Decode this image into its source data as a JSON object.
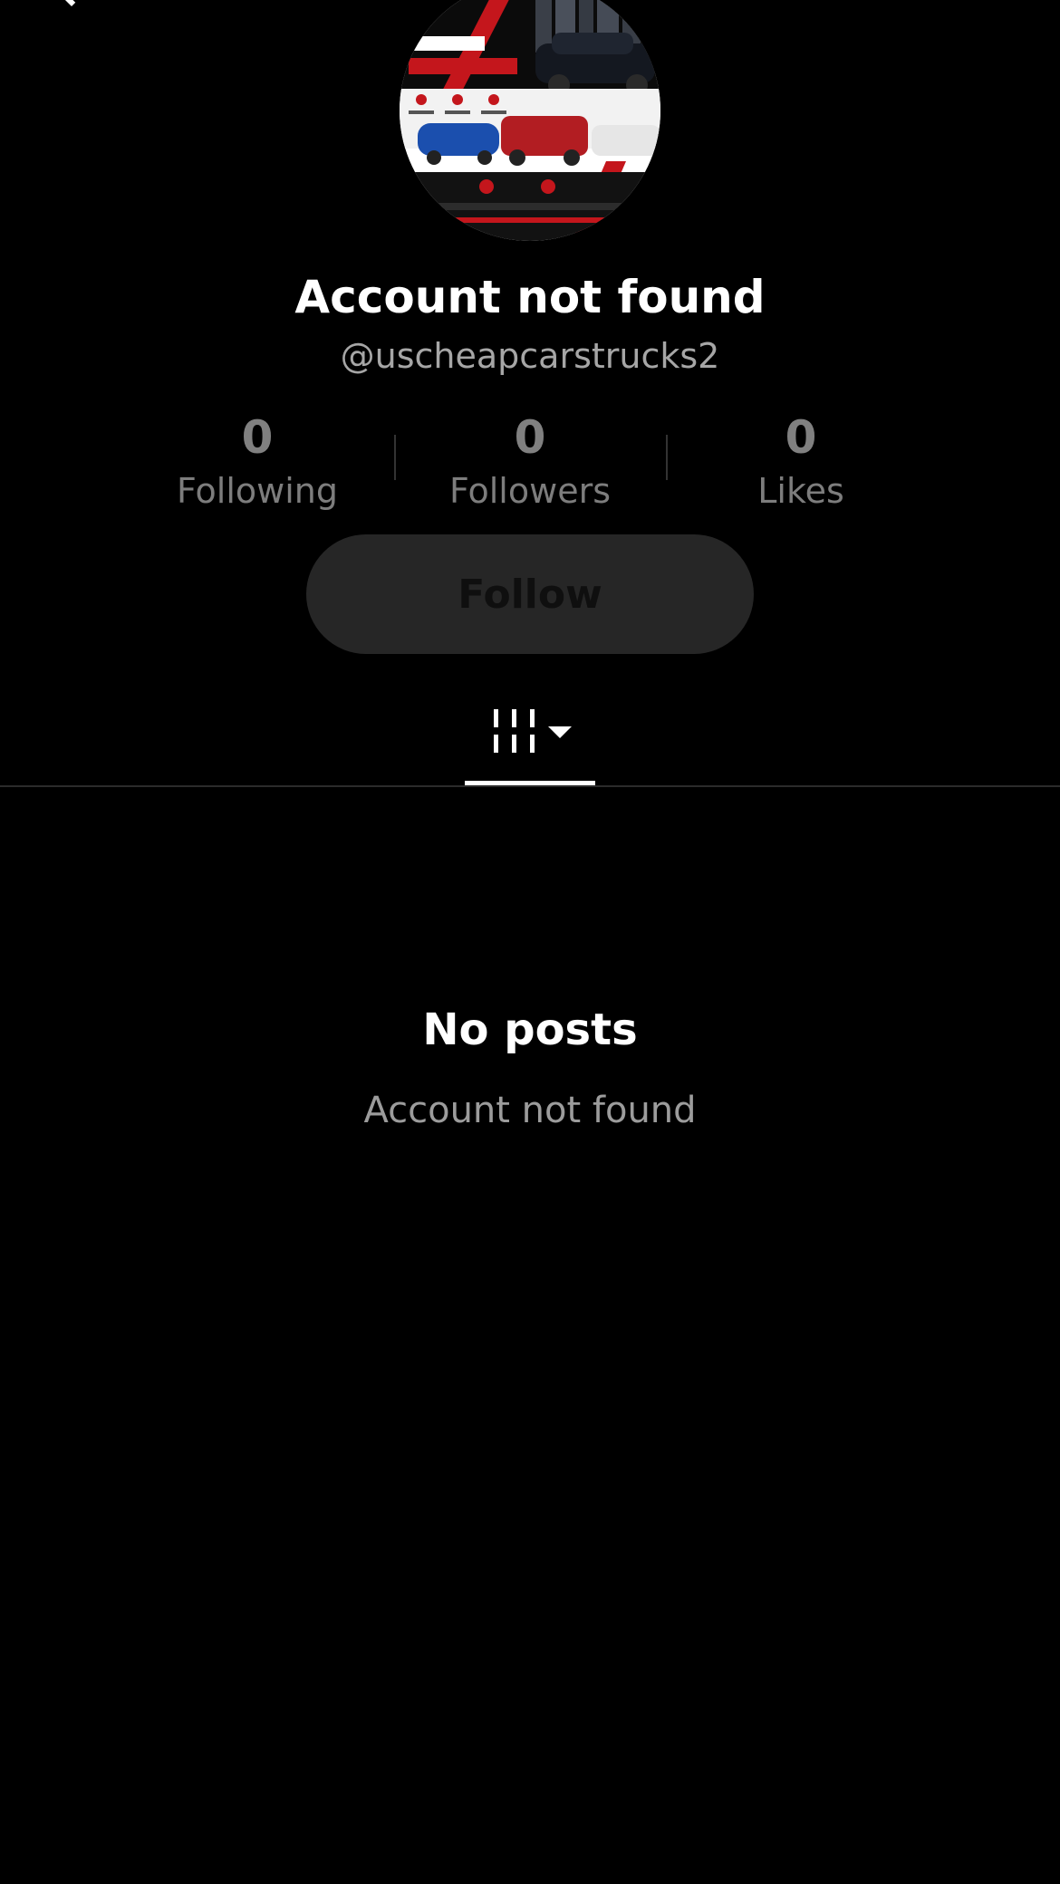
{
  "header": {
    "back_icon": "chevron-left-icon"
  },
  "profile": {
    "avatar_icon": "avatar-image",
    "name": "Account not found",
    "handle": "@uscheapcarstrucks2"
  },
  "stats": [
    {
      "count": "0",
      "label": "Following"
    },
    {
      "count": "0",
      "label": "Followers"
    },
    {
      "count": "0",
      "label": "Likes"
    }
  ],
  "actions": {
    "follow_label": "Follow"
  },
  "tabs": {
    "videos_icon": "grid-icon",
    "dropdown_icon": "caret-down-icon"
  },
  "empty_state": {
    "title": "No posts",
    "subtitle": "Account not found"
  },
  "colors": {
    "background": "#000000",
    "accent_red": "#c4161c",
    "follow_button_bg": "#262626"
  }
}
